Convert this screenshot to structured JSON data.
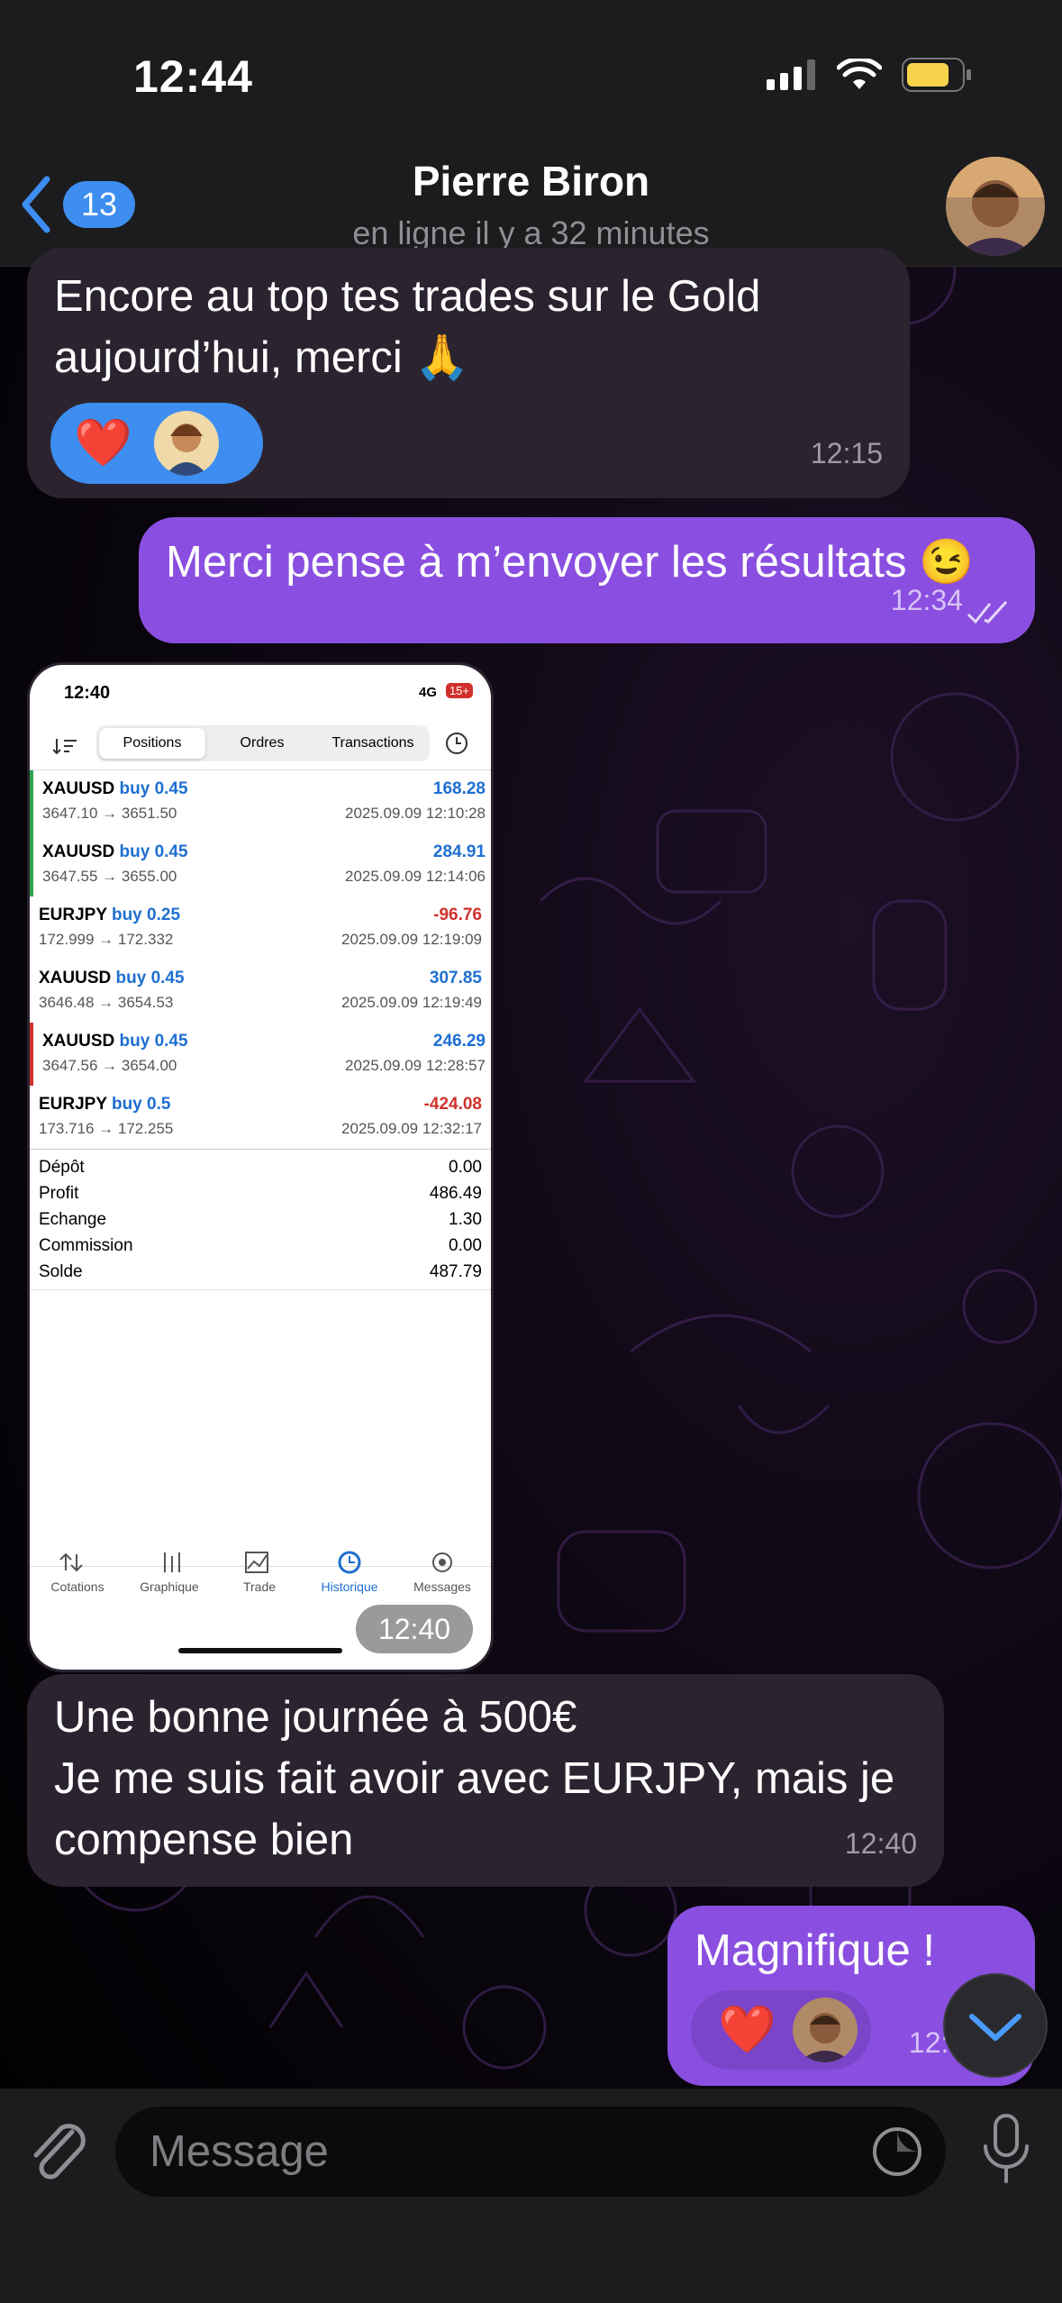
{
  "status_bar": {
    "time": "12:44"
  },
  "header": {
    "back_count": "13",
    "contact_name": "Pierre Biron",
    "contact_status": "en ligne il y a 32 minutes"
  },
  "messages": [
    {
      "direction": "incoming",
      "text_line1": "Encore au top tes trades sur le Gold",
      "text_line2": "aujourd’hui, merci 🙏",
      "time": "12:15",
      "reactions": [
        "❤️",
        "avatar"
      ]
    },
    {
      "direction": "outgoing",
      "text": "Merci pense à m’envoyer les résultats 😉",
      "time": "12:34",
      "read": true
    },
    {
      "direction": "incoming",
      "type": "image",
      "time": "12:40"
    },
    {
      "direction": "incoming",
      "text_line1": "Une bonne journée à 500€",
      "text_line2": "Je me suis fait avoir avec EURJPY, mais je",
      "text_line3": "compense bien",
      "time": "12:40"
    },
    {
      "direction": "outgoing",
      "text": "Magnifique !",
      "time": "12:44",
      "reactions": [
        "❤️",
        "avatar"
      ]
    }
  ],
  "screenshot": {
    "time": "12:40",
    "network": "4G",
    "battery": "15+",
    "tabs": [
      "Positions",
      "Ordres",
      "Transactions"
    ],
    "active_tab": "Positions",
    "trades": [
      {
        "symbol": "XAUUSD",
        "type": "buy 0.45",
        "profit": "168.28",
        "prices": "3647.10 → 3651.50",
        "date": "2025.09.09 12:10:28",
        "sign": "pos"
      },
      {
        "symbol": "XAUUSD",
        "type": "buy 0.45",
        "profit": "284.91",
        "prices": "3647.55 → 3655.00",
        "date": "2025.09.09 12:14:06",
        "sign": "pos"
      },
      {
        "symbol": "EURJPY",
        "type": "buy 0.25",
        "profit": "-96.76",
        "prices": "172.999 → 172.332",
        "date": "2025.09.09 12:19:09",
        "sign": "neg"
      },
      {
        "symbol": "XAUUSD",
        "type": "buy 0.45",
        "profit": "307.85",
        "prices": "3646.48 → 3654.53",
        "date": "2025.09.09 12:19:49",
        "sign": "pos"
      },
      {
        "symbol": "XAUUSD",
        "type": "buy 0.45",
        "profit": "246.29",
        "prices": "3647.56 → 3654.00",
        "date": "2025.09.09 12:28:57",
        "sign": "pos"
      },
      {
        "symbol": "EURJPY",
        "type": "buy 0.5",
        "profit": "-424.08",
        "prices": "173.716 → 172.255",
        "date": "2025.09.09 12:32:17",
        "sign": "neg"
      }
    ],
    "summary": [
      {
        "label": "Dépôt",
        "value": "0.00"
      },
      {
        "label": "Profit",
        "value": "486.49"
      },
      {
        "label": "Echange",
        "value": "1.30"
      },
      {
        "label": "Commission",
        "value": "0.00"
      },
      {
        "label": "Solde",
        "value": "487.79"
      }
    ],
    "tabbar": [
      "Cotations",
      "Graphique",
      "Trade",
      "Historique",
      "Messages"
    ]
  },
  "input": {
    "placeholder": "Message"
  },
  "colors": {
    "accent": "#3d8ef0",
    "outgoing": "#8a4fe0",
    "incoming": "#2b2430"
  }
}
